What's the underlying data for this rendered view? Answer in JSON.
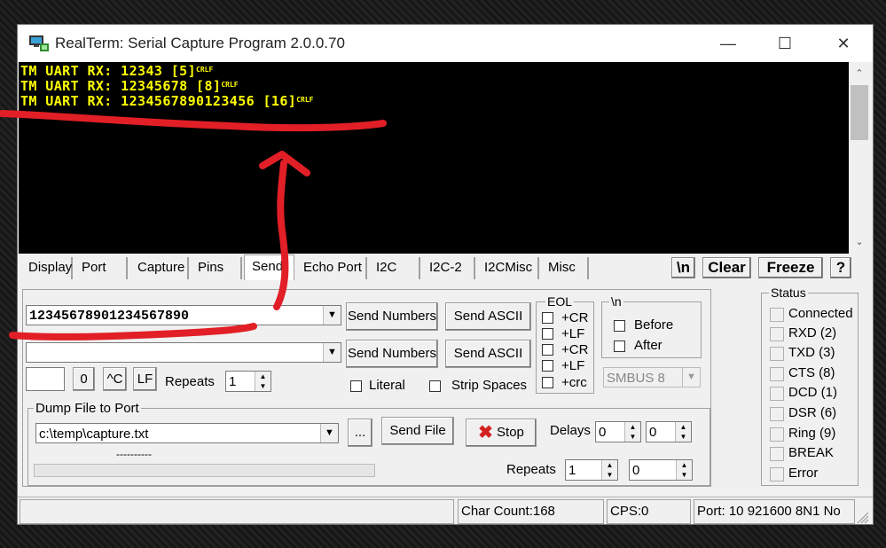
{
  "window": {
    "title": "RealTerm: Serial Capture Program 2.0.0.70"
  },
  "terminal": {
    "lines": [
      {
        "text": "TM UART RX: 12343 [5]",
        "eol": "CRLF"
      },
      {
        "text": "TM UART RX: 12345678 [8]",
        "eol": "CRLF"
      },
      {
        "text": "TM UART RX: 1234567890123456 [16]",
        "eol": "CRLF"
      }
    ],
    "text_color": "#ffff00",
    "background": "#000000"
  },
  "tabs": [
    "Display",
    "Port",
    "Capture",
    "Pins",
    "Send",
    "Echo Port",
    "I2C",
    "I2C-2",
    "I2CMisc",
    "Misc"
  ],
  "active_tab": "Send",
  "toolbar_buttons": {
    "newline": "\\n",
    "clear": "Clear",
    "freeze": "Freeze",
    "help": "?"
  },
  "send": {
    "row1_value": "12345678901234567890",
    "row2_value": "",
    "send_numbers_label": "Send Numbers",
    "send_ascii_label": "Send ASCII",
    "byte_value": "",
    "zero_label": "0",
    "ctrl_c_label": "^C",
    "lf_label": "LF",
    "repeats_label": "Repeats",
    "repeats_value": "1",
    "literal_label": "Literal",
    "strip_spaces_label": "Strip Spaces"
  },
  "eol": {
    "title": "EOL",
    "options": [
      "+CR",
      "+LF",
      "+CR",
      "+LF",
      "+crc"
    ]
  },
  "newline_group": {
    "title": "\\n",
    "before": "Before",
    "after": "After"
  },
  "smbus": {
    "value": "SMBUS 8"
  },
  "dump": {
    "title": "Dump File to Port",
    "file_value": "c:\\temp\\capture.txt",
    "browse_label": "...",
    "send_file_label": "Send File",
    "stop_label": "Stop",
    "delays_label": "Delays",
    "delay1": "0",
    "delay2": "0",
    "progress_text": "----------",
    "repeats_label": "Repeats",
    "repeats1": "1",
    "repeats2": "0"
  },
  "status": {
    "title": "Status",
    "items": [
      "Connected",
      "RXD (2)",
      "TXD (3)",
      "CTS (8)",
      "DCD (1)",
      "DSR (6)",
      "Ring (9)",
      "BREAK",
      "Error"
    ]
  },
  "statusbar": {
    "char_count": "Char Count:168",
    "cps": "CPS:0",
    "port": "Port: 10 921600 8N1 No"
  },
  "colors": {
    "annotation": "#e21f26",
    "stop_icon": "#d42020"
  }
}
